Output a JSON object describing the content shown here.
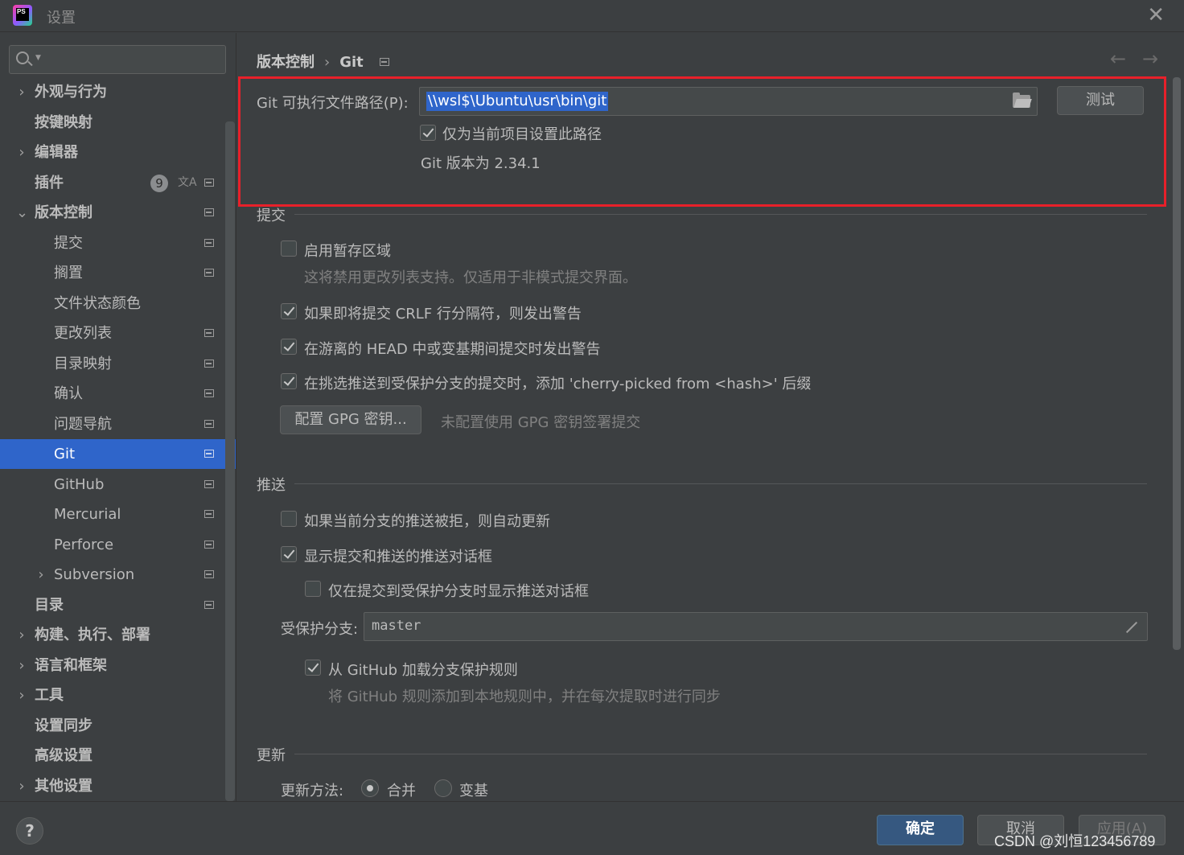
{
  "window": {
    "title": "设置",
    "logo_text": "PS"
  },
  "search": {
    "placeholder": "",
    "value": ""
  },
  "sidebar": {
    "items": [
      {
        "label": "外观与行为",
        "chevron": "›",
        "level": 0
      },
      {
        "label": "按键映射",
        "level": 0
      },
      {
        "label": "编辑器",
        "chevron": "›",
        "level": 0
      },
      {
        "label": "插件",
        "level": 0,
        "badge": "9"
      },
      {
        "label": "版本控制",
        "chevron": "⌄",
        "level": 0
      },
      {
        "label": "提交",
        "level": 1
      },
      {
        "label": "搁置",
        "level": 1
      },
      {
        "label": "文件状态颜色",
        "level": 1
      },
      {
        "label": "更改列表",
        "level": 1
      },
      {
        "label": "目录映射",
        "level": 1
      },
      {
        "label": "确认",
        "level": 1
      },
      {
        "label": "问题导航",
        "level": 1
      },
      {
        "label": "Git",
        "level": 1,
        "selected": true
      },
      {
        "label": "GitHub",
        "level": 1
      },
      {
        "label": "Mercurial",
        "level": 1
      },
      {
        "label": "Perforce",
        "level": 1
      },
      {
        "label": "Subversion",
        "chevron": "›",
        "level": 1
      },
      {
        "label": "目录",
        "level": 0
      },
      {
        "label": "构建、执行、部署",
        "chevron": "›",
        "level": 0
      },
      {
        "label": "语言和框架",
        "chevron": "›",
        "level": 0
      },
      {
        "label": "工具",
        "chevron": "›",
        "level": 0
      },
      {
        "label": "设置同步",
        "level": 0
      },
      {
        "label": "高级设置",
        "level": 0
      },
      {
        "label": "其他设置",
        "chevron": "›",
        "level": 0
      }
    ]
  },
  "breadcrumb": {
    "parent": "版本控制",
    "separator": "›",
    "current": "Git"
  },
  "git": {
    "exec_label": "Git 可执行文件路径(P):",
    "exec_path": "\\\\wsl$\\Ubuntu\\usr\\bin\\git",
    "test_button": "测试",
    "project_only_label": "仅为当前项目设置此路径",
    "project_only_checked": true,
    "version_text": "Git 版本为 2.34.1"
  },
  "commit": {
    "title": "提交",
    "staging_label": "启用暂存区域",
    "staging_checked": false,
    "staging_hint": "这将禁用更改列表支持。仅适用于非模式提交界面。",
    "crlf_label": "如果即将提交 CRLF 行分隔符，则发出警告",
    "crlf_checked": true,
    "head_label": "在游离的 HEAD 中或变基期间提交时发出警告",
    "head_checked": true,
    "cherry_label": "在挑选推送到受保护分支的提交时，添加 'cherry-picked from <hash>' 后缀",
    "cherry_checked": true,
    "gpg_button": "配置 GPG 密钥...",
    "gpg_hint": "未配置使用 GPG 密钥签署提交"
  },
  "push": {
    "title": "推送",
    "auto_update_label": "如果当前分支的推送被拒，则自动更新",
    "auto_update_checked": false,
    "show_dialog_label": "显示提交和推送的推送对话框",
    "show_dialog_checked": true,
    "protected_only_label": "仅在提交到受保护分支时显示推送对话框",
    "protected_only_checked": false,
    "protected_branches_label": "受保护分支:",
    "protected_branches_value": "master",
    "github_rules_label": "从 GitHub 加载分支保护规则",
    "github_rules_checked": true,
    "github_rules_hint": "将 GitHub 规则添加到本地规则中，并在每次提取时进行同步"
  },
  "update": {
    "title": "更新",
    "method_label": "更新方法:",
    "merge_label": "合并",
    "rebase_label": "变基",
    "selected": "merge"
  },
  "footer": {
    "help_label": "?",
    "ok_label": "确定",
    "cancel_label": "取消",
    "apply_label": "应用(A)",
    "watermark": "CSDN @刘恒123456789"
  },
  "colors": {
    "background": "#3c3f41",
    "selection": "#2f65ca",
    "highlight_border": "#e8202a",
    "primary_button": "#365880"
  }
}
